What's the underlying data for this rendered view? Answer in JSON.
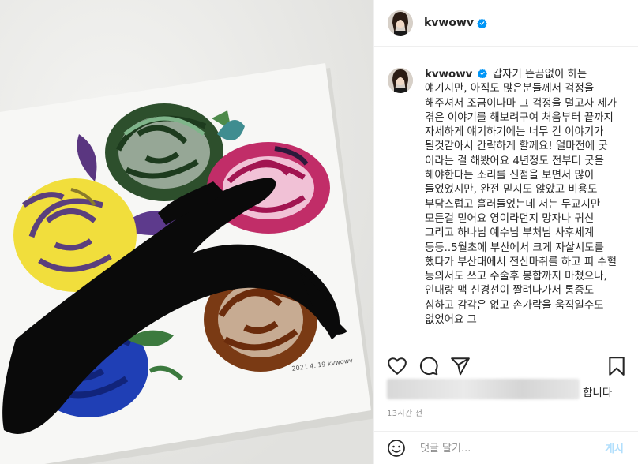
{
  "post": {
    "username": "kvwowv",
    "verified": true,
    "more_label": "···"
  },
  "caption": {
    "username": "kvwowv",
    "text": "갑자기 뜬끔없이 하는 얘기지만, 아직도 많은분들께서 걱정을 해주셔서 조금이나마 그 걱정을 덜고자 제가 겪은 이야기를 해보려구여 처음부터 끝까지 자세하게 얘기하기에는 너무 긴 이야기가 될것같아서 간략하게 할께요! 얼마전에 굿 이라는 걸 해봤어요 4년정도 전부터 굿을 해야한다는 소리를 신점을 보면서 많이 들었었지만, 완전 믿지도 않았고 비용도 부담스럽고 흘러들었는데 저는 무교지만 모든걸 믿어요 영이라던지 망자나 귀신 그리고 하나님 예수님 부처님 사후세계 등등..5월초에 부산에서 크게 자살시도를 했다가 부산대에서 전신마취를 하고 피 수혈 등의서도 쓰고 수술후 봉합까지 마쳤으나, 인대랑 맥 신경선이 짤려나가서 통증도 심하고 감각은 없고 손가락을 움직일수도 없었어요 그"
  },
  "likes": {
    "suffix": "합니다"
  },
  "timestamp": "13시간 전",
  "comment": {
    "placeholder": "댓글 달기...",
    "post_label": "게시"
  },
  "painting": {
    "signature": "2021 4. 19 kvwowv"
  },
  "icons": [
    "heart-icon",
    "comment-icon",
    "share-icon",
    "bookmark-icon",
    "emoji-icon",
    "verified-icon",
    "more-icon"
  ],
  "colors": {
    "verified": "#0095f6",
    "post_button_disabled": "#b2dffc",
    "border": "#efefef",
    "muted": "#8e8e8e"
  }
}
